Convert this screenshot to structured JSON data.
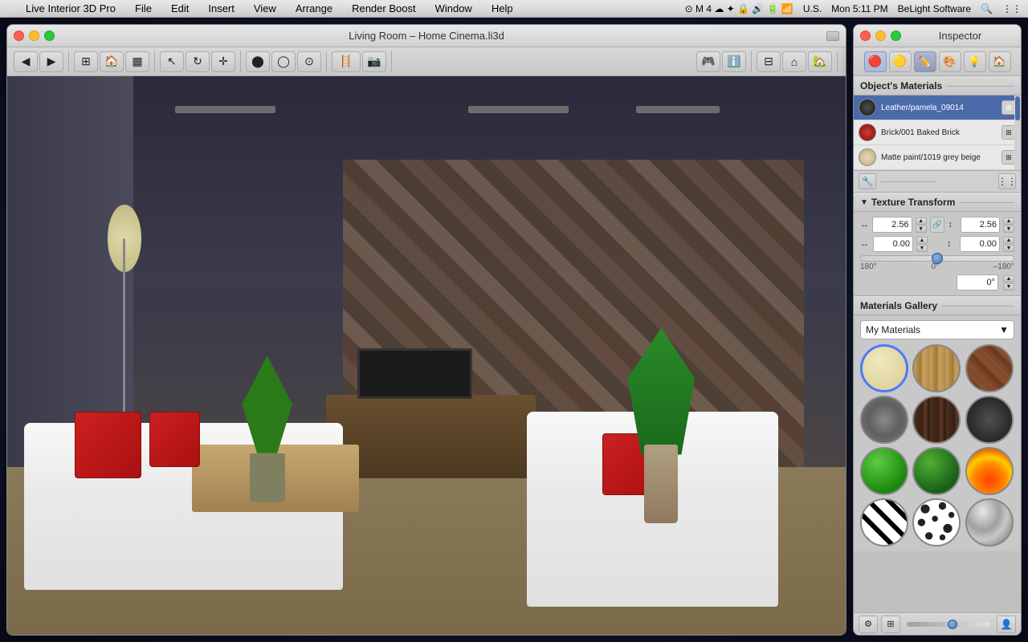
{
  "menubar": {
    "apple": "",
    "app_name": "Live Interior 3D Pro",
    "menus": [
      "File",
      "Edit",
      "Insert",
      "View",
      "Arrange",
      "Render Boost",
      "Window",
      "Help"
    ],
    "right_info": "Mon 5:11 PM",
    "company": "BeLight Software",
    "locale": "U.S."
  },
  "doc_window": {
    "title": "Living Room – Home Cinema.li3d",
    "traffic_lights": {
      "close": "close",
      "minimize": "minimize",
      "maximize": "maximize"
    }
  },
  "inspector": {
    "title": "Inspector",
    "tabs": [
      "materials-tab",
      "object-tab",
      "edit-tab",
      "texture-tab",
      "light-tab",
      "house-tab"
    ],
    "tab_icons": [
      "🔴",
      "🟡",
      "✏️",
      "🎨",
      "💡",
      "🏠"
    ],
    "objects_materials_label": "Object's Materials",
    "materials": [
      {
        "name": "Leather/pamela_09014",
        "swatch_type": "dark-grey",
        "selected": true
      },
      {
        "name": "Brick/001 Baked Brick",
        "swatch_type": "brick-red",
        "selected": false
      },
      {
        "name": "Matte paint/1019 grey beige",
        "swatch_type": "beige",
        "selected": false
      }
    ],
    "texture_transform": {
      "label": "Texture Transform",
      "width_value": "2.56",
      "height_value": "2.56",
      "offset_x": "0.00",
      "offset_y": "0.00",
      "angle": "0°",
      "slider_min": "180°",
      "slider_mid": "0°",
      "slider_max": "–180°"
    },
    "gallery": {
      "label": "Materials Gallery",
      "dropdown_value": "My Materials",
      "items": [
        {
          "type": "cream",
          "selected": true
        },
        {
          "type": "wood"
        },
        {
          "type": "brick-brown"
        },
        {
          "type": "stone-grey"
        },
        {
          "type": "dark-wood"
        },
        {
          "type": "dark-grey"
        },
        {
          "type": "green-ball"
        },
        {
          "type": "green-ball2"
        },
        {
          "type": "fire"
        },
        {
          "type": "zebra"
        },
        {
          "type": "dalmatian"
        },
        {
          "type": "chrome"
        }
      ]
    }
  }
}
